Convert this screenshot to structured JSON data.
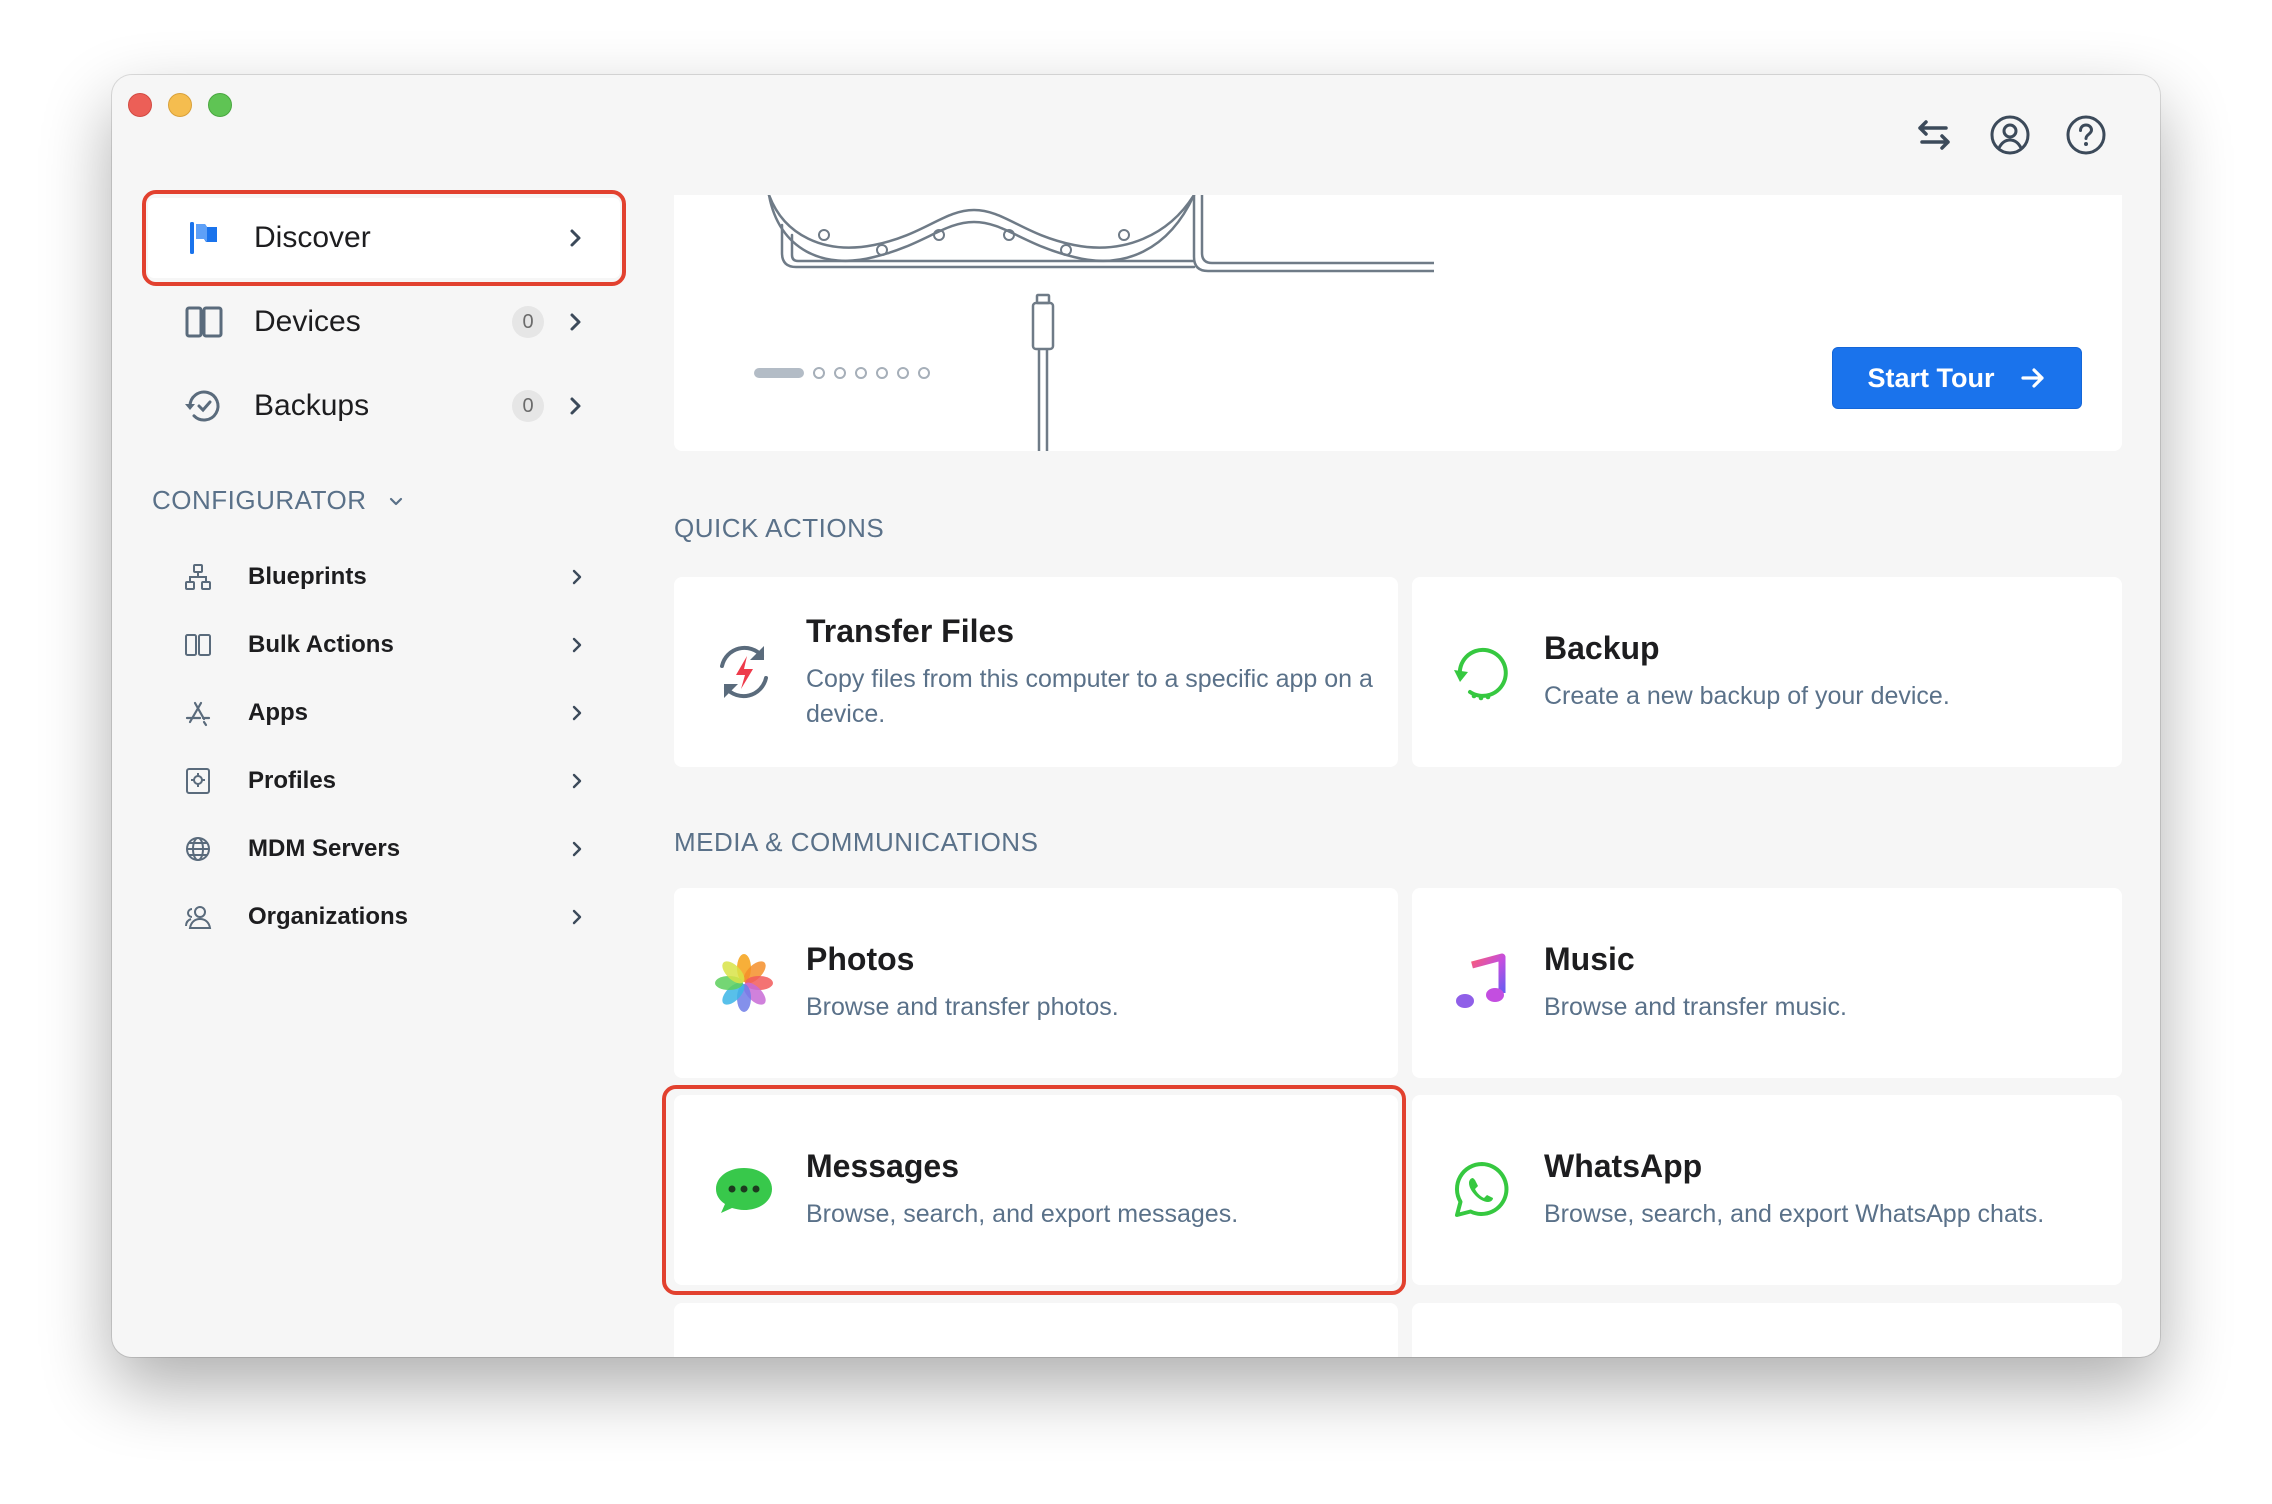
{
  "sidebar": {
    "items": [
      {
        "label": "Discover"
      },
      {
        "label": "Devices",
        "count": "0"
      },
      {
        "label": "Backups",
        "count": "0"
      }
    ],
    "section_label": "CONFIGURATOR",
    "sub_items": [
      {
        "label": "Blueprints"
      },
      {
        "label": "Bulk Actions"
      },
      {
        "label": "Apps"
      },
      {
        "label": "Profiles"
      },
      {
        "label": "MDM Servers"
      },
      {
        "label": "Organizations"
      }
    ]
  },
  "hero": {
    "button_label": "Start Tour",
    "carousel_total": 7,
    "carousel_current": 1
  },
  "sections": {
    "quick_actions": "QUICK ACTIONS",
    "media": "MEDIA & COMMUNICATIONS"
  },
  "cards": {
    "transfer_files": {
      "title": "Transfer Files",
      "desc": "Copy files from this computer to a specific app on a device."
    },
    "backup": {
      "title": "Backup",
      "desc": "Create a new backup of your device."
    },
    "photos": {
      "title": "Photos",
      "desc": "Browse and transfer photos."
    },
    "music": {
      "title": "Music",
      "desc": "Browse and transfer music."
    },
    "messages": {
      "title": "Messages",
      "desc": "Browse, search, and export messages."
    },
    "whatsapp": {
      "title": "WhatsApp",
      "desc": "Browse, search, and export WhatsApp chats."
    }
  },
  "colors": {
    "accent": "#1a73ec",
    "highlight": "#e2412f",
    "section_text": "#5a7189"
  }
}
